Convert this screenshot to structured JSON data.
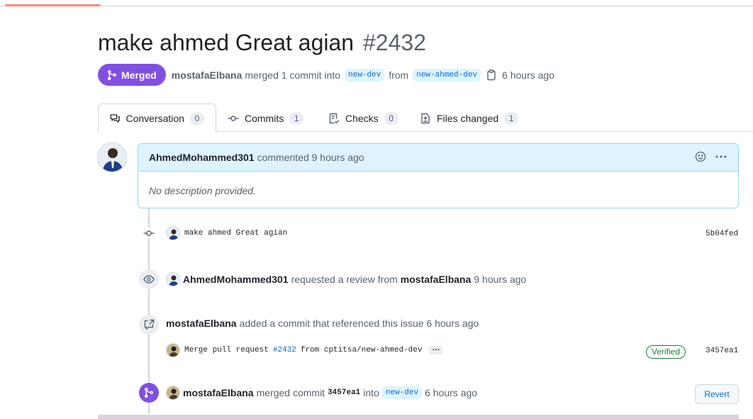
{
  "pr": {
    "title": "make ahmed Great agian",
    "number": "#2432",
    "state": "Merged",
    "merger": "mostafaElbana",
    "merged_text": "merged 1 commit into",
    "base_branch": "new-dev",
    "from_text": "from",
    "head_branch": "new-ahmed-dev",
    "merged_time": "6 hours ago"
  },
  "tabs": [
    {
      "label": "Conversation",
      "count": "0",
      "icon": "comment-discussion-icon"
    },
    {
      "label": "Commits",
      "count": "1",
      "icon": "git-commit-icon"
    },
    {
      "label": "Checks",
      "count": "0",
      "icon": "checklist-icon"
    },
    {
      "label": "Files changed",
      "count": "1",
      "icon": "file-diff-icon"
    }
  ],
  "comment": {
    "author": "AhmedMohammed301",
    "action": "commented 9 hours ago",
    "body": "No description provided."
  },
  "timeline": {
    "commit": {
      "message": "make ahmed Great agian",
      "sha": "5b04fed"
    },
    "review": {
      "author": "AhmedMohammed301",
      "text": "requested a review from",
      "reviewer": "mostafaElbana",
      "time": "9 hours ago"
    },
    "reference": {
      "author": "mostafaElbana",
      "text": "added a commit that referenced this issue 6 hours ago"
    },
    "ref_commit": {
      "prefix": "Merge pull request",
      "pr_link": "#2432",
      "suffix": "from cptitsa/new-ahmed-dev",
      "more": "…",
      "badge": "Verified",
      "sha": "3457ea1"
    },
    "merged": {
      "author": "mostafaElbana",
      "text": "merged commit",
      "sha": "3457ea1",
      "into": "into",
      "branch": "new-dev",
      "time": "6 hours ago",
      "revert": "Revert"
    }
  },
  "colors": {
    "accent": "#fd8c73",
    "merged": "#8250df",
    "link": "#0969da",
    "verified": "#1a7f37",
    "comment_header": "#ddf4ff"
  }
}
